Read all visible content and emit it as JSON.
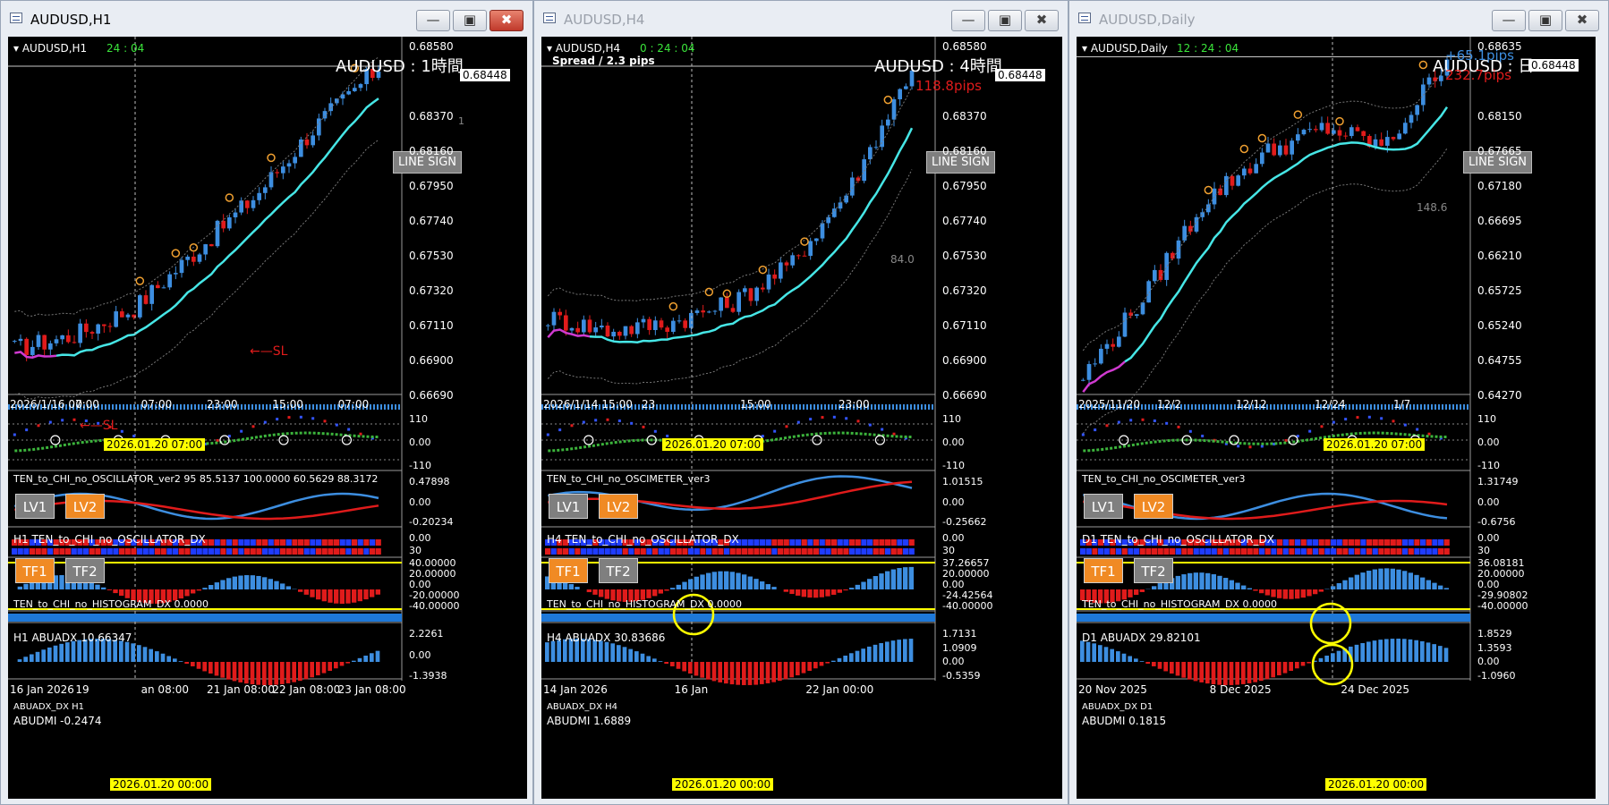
{
  "windows": [
    {
      "title": "AUDUSD,H1",
      "active": true,
      "chart_label": "AUDUSD,H1",
      "countdown": "24 : 04",
      "big_label": "AUDUSD : 1時間",
      "spread": "",
      "pips_top": "",
      "pips_bottom": "",
      "side_value": "1",
      "line_sign": "LINE SIGN",
      "prices": [
        "0.68580",
        "0.68448",
        "0.68370",
        "0.68160",
        "0.67950",
        "0.67740",
        "0.67530",
        "0.67320",
        "0.67110",
        "0.66900",
        "0.66690"
      ],
      "current_price": "0.68448",
      "sl_labels": [
        "SL",
        "SL"
      ],
      "time_labels": [
        "2026/1/16 07:00",
        "0",
        "07:00",
        "23:00",
        "15:00",
        "07:00"
      ],
      "cursor_time": "2026.01.20 07:00",
      "osc_title": "TEN_to_CHI_no_OSCILLATOR_ver2 95 85.5137 100.0000 60.5629 88.3172",
      "osc_levels": [
        "110",
        "0.00",
        "-110"
      ],
      "lv_buttons": [
        "LV1",
        "LV2"
      ],
      "dx_title": "H1 TEN_to_CHI_no_OSCILLATOR_DX",
      "dx_levels": [
        "0.47898",
        "0.00",
        "-0.20234"
      ],
      "tf_buttons": [
        "TF1",
        "TF2"
      ],
      "hist_title": "TEN_to_CHI_no_HISTOGRAM_DX 0.0000",
      "hist_levels": [
        "0.00",
        "30"
      ],
      "abuadx_title": "H1 ABUADX  10.66347",
      "abuadx_levels": [
        "40.00000",
        "20.00000",
        "0.00",
        "-20.00000",
        "-40.00000"
      ],
      "abuadx_dx_title": "ABUADX_DX H1",
      "abudmi_title": "ABUDMI  -0.2474",
      "abudmi_levels": [
        "2.2261",
        "0.00",
        "-1.3938"
      ],
      "bottom_times": [
        "16 Jan 2026",
        "19",
        "an 08:00",
        "21 Jan 08:00",
        "22 Jan 08:00",
        "23 Jan 08:00"
      ],
      "bottom_cursor": "2026.01.20 00:00"
    },
    {
      "title": "AUDUSD,H4",
      "active": false,
      "chart_label": "AUDUSD,H4",
      "countdown": "0 : 24 : 04",
      "big_label": "AUDUSD : 4時間",
      "spread": "Spread / 2.3 pips",
      "pips_top": "",
      "pips_bottom": "118.8pips",
      "side_value": "84.0",
      "line_sign": "LINE SIGN",
      "prices": [
        "0.68580",
        "0.68448",
        "0.68370",
        "0.68160",
        "0.67950",
        "0.67740",
        "0.67530",
        "0.67320",
        "0.67110",
        "0.66900",
        "0.66690"
      ],
      "current_price": "0.68448",
      "sl_labels": [],
      "time_labels": [
        "2026/1/14 15:00",
        "23",
        "15:00",
        "23:00"
      ],
      "cursor_time": "2026.01.20 07:00",
      "osc_title": "TEN_to_CHI_no_OSCIMETER_ver3",
      "osc_levels": [
        "110",
        "0.00",
        "-110"
      ],
      "lv_buttons": [
        "LV1",
        "LV2"
      ],
      "dx_title": "H4 TEN_to_CHI_no_OSCILLATOR_DX",
      "dx_levels": [
        "1.01515",
        "0.00",
        "-0.25662"
      ],
      "tf_buttons": [
        "TF1",
        "TF2"
      ],
      "hist_title": "TEN_to_CHI_no_HISTOGRAM_DX 0.0000",
      "hist_levels": [
        "0.00",
        "30"
      ],
      "abuadx_title": "H4 ABUADX  30.83686",
      "abuadx_levels": [
        "37.26657",
        "20.00000",
        "0.00",
        "-24.42564",
        "-40.00000"
      ],
      "abuadx_dx_title": "ABUADX_DX H4",
      "abudmi_title": "ABUDMI  1.6889",
      "abudmi_levels": [
        "1.7131",
        "1.0909",
        "0.00",
        "-0.5359"
      ],
      "bottom_times": [
        "14 Jan 2026",
        "16 Jan",
        "22 Jan 00:00"
      ],
      "bottom_cursor": "2026.01.20 00:00"
    },
    {
      "title": "AUDUSD,Daily",
      "active": false,
      "chart_label": "AUDUSD,Daily",
      "countdown": "12 : 24 : 04",
      "big_label": "AUDUSD : 日",
      "spread": "",
      "pips_top": "+65.1pips",
      "pips_bottom": "232.7pips",
      "side_value": "148.6",
      "line_sign": "LINE SIGN",
      "prices": [
        "0.68635",
        "0.68448",
        "0.68150",
        "0.67665",
        "0.67180",
        "0.66695",
        "0.66210",
        "0.65725",
        "0.65240",
        "0.64755",
        "0.64270"
      ],
      "current_price": "0.68448",
      "sl_labels": [],
      "time_labels": [
        "2025/11/20",
        "12/2",
        "12/12",
        "12/24",
        "1/7"
      ],
      "cursor_time": "2026.01.20 07:00",
      "osc_title": "TEN_to_CHI_no_OSCIMETER_ver3",
      "osc_levels": [
        "110",
        "0.00",
        "-110"
      ],
      "lv_buttons": [
        "LV1",
        "LV2"
      ],
      "dx_title": "D1 TEN_to_CHI_no_OSCILLATOR_DX",
      "dx_levels": [
        "1.31749",
        "0.00",
        "-0.6756"
      ],
      "tf_buttons": [
        "TF1",
        "TF2"
      ],
      "hist_title": "TEN_to_CHI_no_HISTOGRAM_DX 0.0000",
      "hist_levels": [
        "0.00",
        "30"
      ],
      "abuadx_title": "D1 ABUADX  29.82101",
      "abuadx_levels": [
        "36.08181",
        "20.00000",
        "0.00",
        "-29.90802",
        "-40.00000"
      ],
      "abuadx_dx_title": "ABUADX_DX D1",
      "abudmi_title": "ABUDMI  0.1815",
      "abudmi_levels": [
        "1.8529",
        "1.3593",
        "0.00",
        "-1.0960"
      ],
      "bottom_times": [
        "20 Nov 2025",
        "8 Dec 2025",
        "24 Dec 2025"
      ],
      "bottom_cursor": "2026.01.20 00:00"
    }
  ],
  "colors": {
    "bull": "#3d8ee0",
    "bear": "#e01b1b",
    "ma": "#46e6e6",
    "ma_early": "#d03ad0",
    "cursor_label_bg": "#ffff00",
    "button_orange": "#f08a24",
    "button_gray": "#7f7f7f"
  }
}
